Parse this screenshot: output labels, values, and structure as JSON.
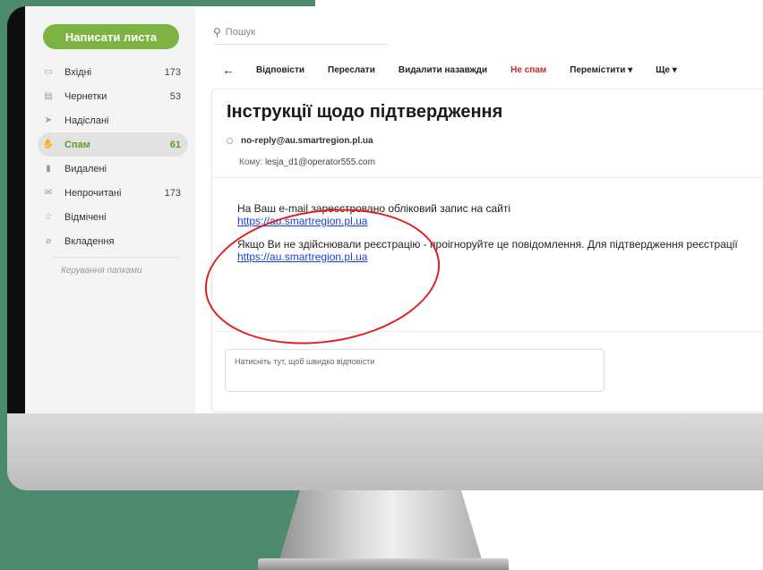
{
  "compose": {
    "label": "Написати листа"
  },
  "search": {
    "placeholder": "Пошук"
  },
  "sidebar": {
    "items": [
      {
        "label": "Вхідні",
        "count": "173",
        "icon": "inbox-icon"
      },
      {
        "label": "Чернетки",
        "count": "53",
        "icon": "drafts-icon"
      },
      {
        "label": "Надіслані",
        "count": "",
        "icon": "sent-icon"
      },
      {
        "label": "Спам",
        "count": "61",
        "icon": "spam-icon"
      },
      {
        "label": "Видалені",
        "count": "",
        "icon": "trash-icon"
      },
      {
        "label": "Непрочитані",
        "count": "173",
        "icon": "unread-icon"
      },
      {
        "label": "Відмічені",
        "count": "",
        "icon": "star-icon"
      },
      {
        "label": "Вкладення",
        "count": "",
        "icon": "attachment-icon"
      }
    ],
    "folders_link": "Керування папками"
  },
  "toolbar": {
    "reply": "Відповісти",
    "forward": "Переслати",
    "delete_forever": "Видалити назавжди",
    "not_spam": "Не спам",
    "move": "Перемістити ▾",
    "more": "Ще ▾"
  },
  "message": {
    "subject": "Інструкції щодо підтвердження",
    "from": "no-reply@au.smartregion.pl.ua",
    "to_label": "Кому:",
    "to": "lesja_d1@operator555.com",
    "line1": "На Ваш e-mail зареєстровано обліковий запис на сайті",
    "link1": "https://au.smartregion.pl.ua",
    "line2": "Якщо Ви не здійснювали реєстрацію - проігноруйте це повідомлення. Для підтвердження реєстрації",
    "link2": "https://au.smartregion.pl.ua"
  },
  "quick_reply": {
    "placeholder": "Натисніть тут, щоб швидко відповісти"
  },
  "colors": {
    "accent_green": "#7cb342",
    "spam_red": "#c62828",
    "link_blue": "#1a3fd6",
    "annotation_red": "#e02020",
    "background_green": "#4e8a6e"
  }
}
